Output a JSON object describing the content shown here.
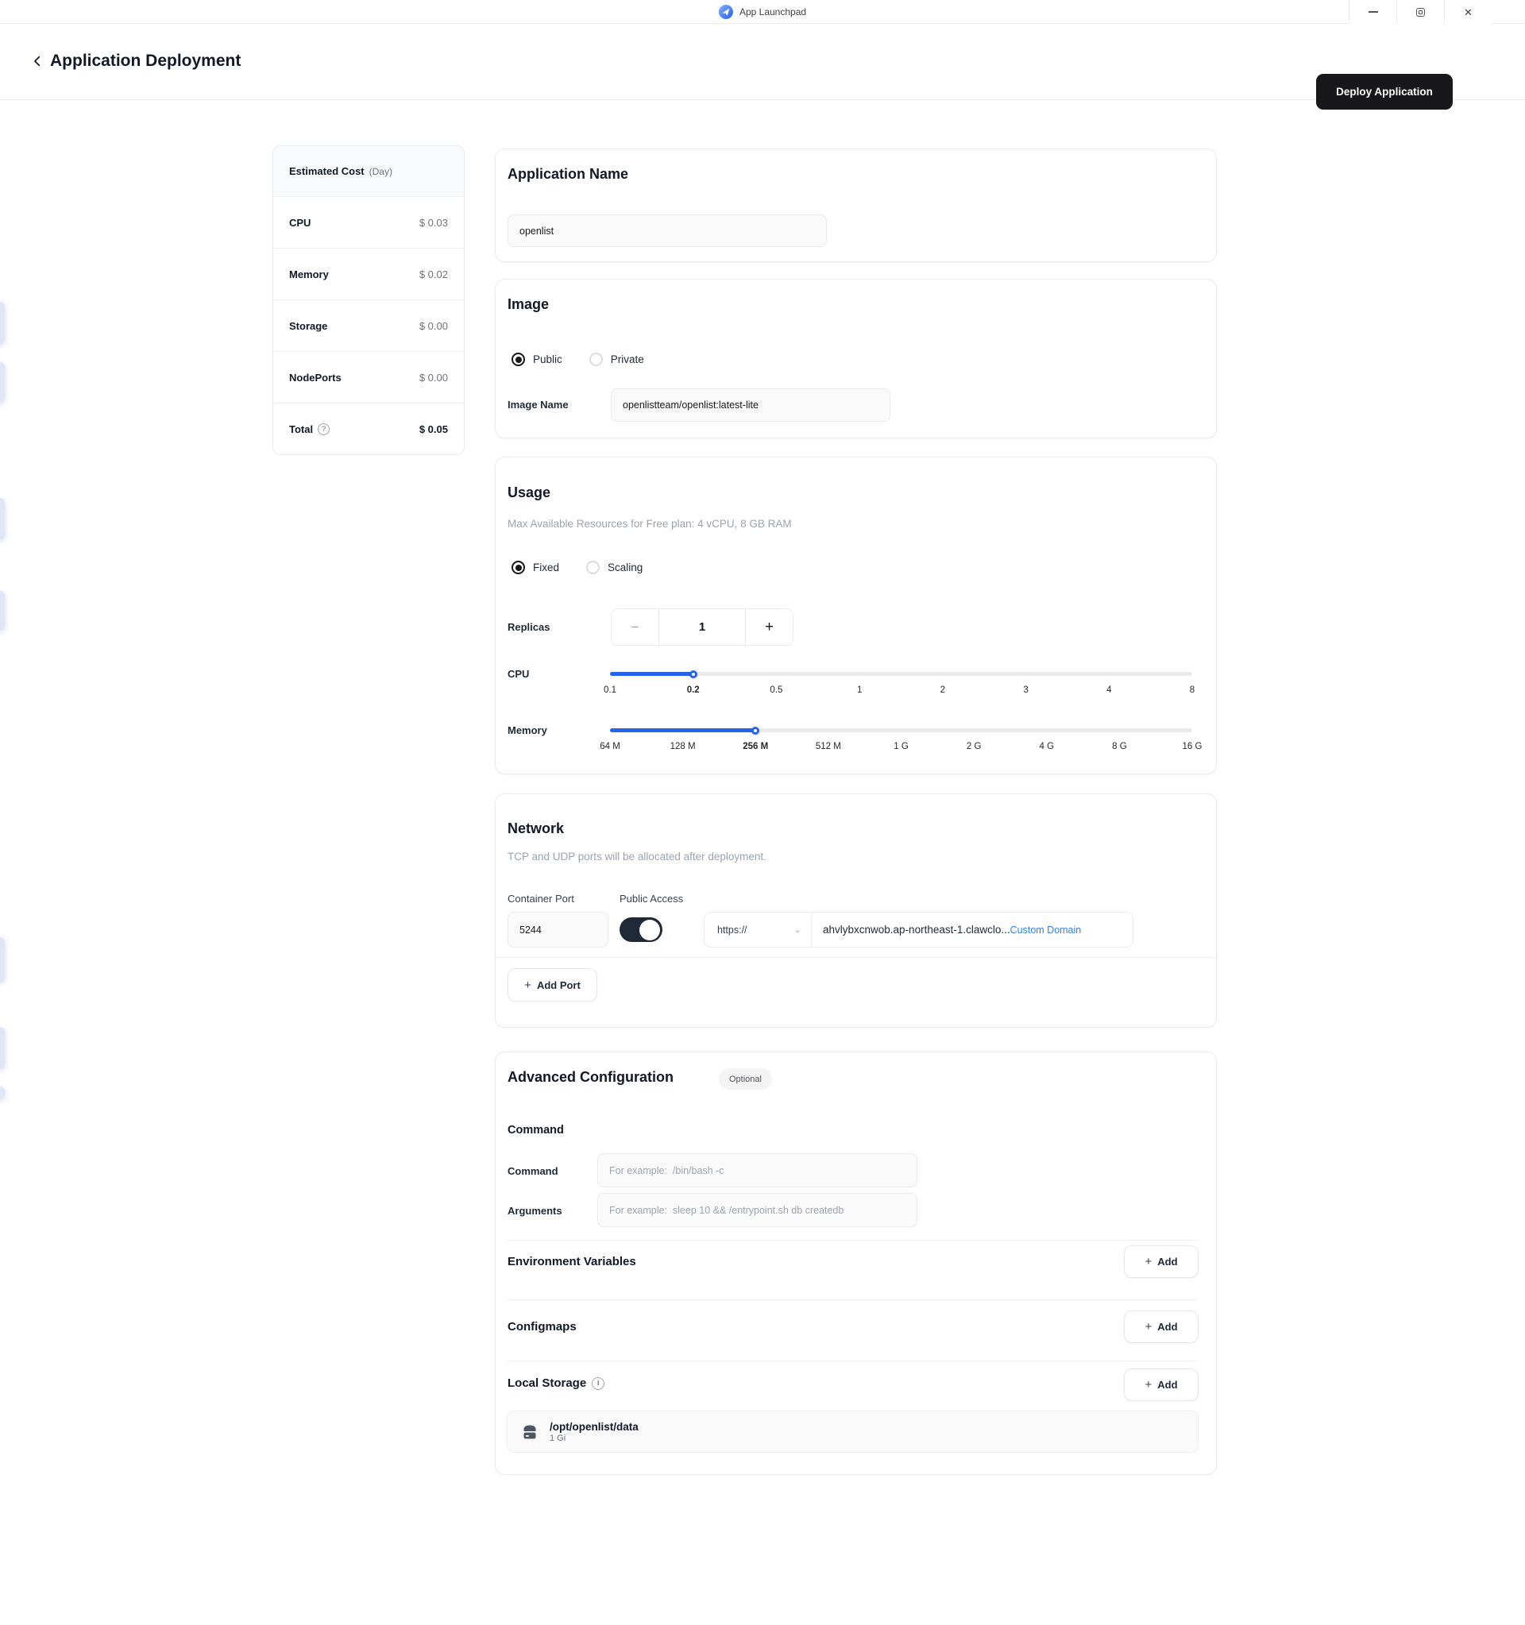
{
  "titlebar": {
    "app_name": "App Launchpad"
  },
  "header": {
    "title": "Application Deployment",
    "deploy_label": "Deploy Application"
  },
  "cost": {
    "title": "Estimated Cost",
    "unit": "(Day)",
    "rows": [
      {
        "label": "CPU",
        "value": "$ 0.03"
      },
      {
        "label": "Memory",
        "value": "$ 0.02"
      },
      {
        "label": "Storage",
        "value": "$ 0.00"
      },
      {
        "label": "NodePorts",
        "value": "$ 0.00"
      }
    ],
    "total_label": "Total",
    "total_value": "$ 0.05"
  },
  "app_name": {
    "title": "Application Name",
    "value": "openlist"
  },
  "image": {
    "title": "Image",
    "public_label": "Public",
    "private_label": "Private",
    "name_label": "Image Name",
    "name_value": "openlistteam/openlist:latest-lite"
  },
  "usage": {
    "title": "Usage",
    "subtitle": "Max Available Resources for Free plan: 4 vCPU, 8 GB RAM",
    "fixed_label": "Fixed",
    "scaling_label": "Scaling",
    "replicas_label": "Replicas",
    "replicas_value": "1",
    "minus": "−",
    "plus": "+",
    "cpu": {
      "label": "CPU",
      "ticks": [
        "0.1",
        "0.2",
        "0.5",
        "1",
        "2",
        "3",
        "4",
        "8"
      ],
      "active_index": 1,
      "percent": 14.3
    },
    "memory": {
      "label": "Memory",
      "ticks": [
        "64 M",
        "128 M",
        "256 M",
        "512 M",
        "1 G",
        "2 G",
        "4 G",
        "8 G",
        "16 G"
      ],
      "active_index": 2,
      "percent": 25
    }
  },
  "network": {
    "title": "Network",
    "subtitle": "TCP and UDP ports will be allocated after deployment.",
    "port_label": "Container Port",
    "access_label": "Public Access",
    "port_value": "5244",
    "protocol": "https://",
    "domain": "ahvlybxcnwob.ap-northeast-1.clawclo...",
    "custom_domain": "Custom Domain",
    "add_port_label": "Add Port"
  },
  "advanced": {
    "title": "Advanced Configuration",
    "optional_label": "Optional",
    "command_section": "Command",
    "command_label": "Command",
    "command_placeholder": "For example:  /bin/bash -c",
    "arguments_label": "Arguments",
    "arguments_placeholder": "For example:  sleep 10 && /entrypoint.sh db createdb",
    "env_label": "Environment Variables",
    "configmaps_label": "Configmaps",
    "local_storage_label": "Local Storage",
    "add_label": "Add",
    "storage": {
      "path": "/opt/openlist/data",
      "size": "1 Gi"
    }
  },
  "icons": {
    "question": "?",
    "info": "i",
    "chevron_down": "⌄",
    "plus": "+",
    "close": "✕"
  }
}
